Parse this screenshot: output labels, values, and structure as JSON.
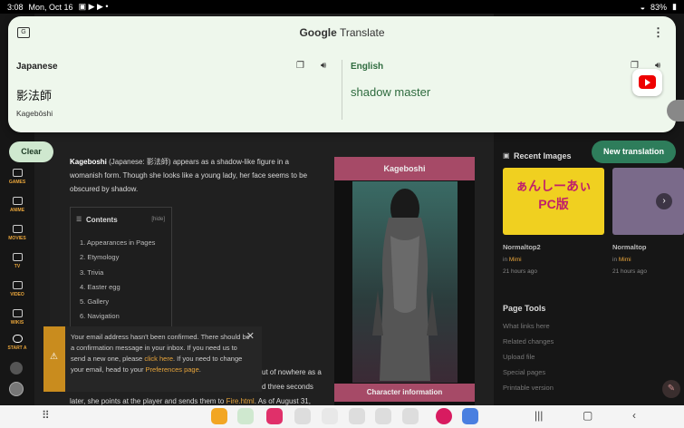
{
  "status_bar": {
    "time": "3:08",
    "date": "Mon, Oct 16",
    "battery": "83%"
  },
  "wiki": {
    "rail": [
      {
        "label": "GAMES",
        "icon": "gamepad-icon"
      },
      {
        "label": "ANIME",
        "icon": "tv-icon"
      },
      {
        "label": "MOVIES",
        "icon": "film-icon"
      },
      {
        "label": "TV",
        "icon": "tv-icon"
      },
      {
        "label": "VIDEO",
        "icon": "video-icon"
      },
      {
        "label": "WIKIS",
        "icon": "book-icon"
      },
      {
        "label": "START A",
        "icon": "plus-icon"
      }
    ],
    "intro_name": "Kageboshi",
    "intro_rest": " (Japanese: 影法師) appears as a shadow-like figure in a womanish form. Though she looks like a young lady, her face seems to be obscured by shadow.",
    "toc": {
      "title": "Contents",
      "hide": "[hide]",
      "items": [
        "1. Appearances in Pages",
        "2. Etymology",
        "3. Trivia",
        "4. Easter egg",
        "5. Gallery",
        "6. Navigation"
      ]
    },
    "body_frag_1": "ut of nowhere as a",
    "body_frag_2": "d three seconds",
    "body_frag_3": "later, she points at the player and sends them to ",
    "body_link": "Fire.html",
    "body_frag_4": ". As of August 31,",
    "infobox": {
      "title": "Kageboshi",
      "footer": "Character information"
    },
    "sidebar": {
      "recent_title": "Recent Images",
      "images": [
        {
          "title": "Normaltop2",
          "in": "in",
          "author": "Mimi",
          "time": "21 hours ago",
          "caption": "ぁんしーあぃ\nPC版"
        },
        {
          "title": "Normaltop",
          "in": "in",
          "author": "Mimi",
          "time": "21 hours ago"
        }
      ],
      "tools_title": "Page Tools",
      "tools": [
        "What links here",
        "Related changes",
        "Upload file",
        "Special pages",
        "Printable version"
      ]
    },
    "notice": {
      "text1": "Your email address hasn't been confirmed. There should be a confirmation message in your inbox. If you need us to send a new one, please ",
      "link1": "click here",
      "text2": ". If you need to change your email, head to your ",
      "link2": "Preferences page",
      "text3": "."
    }
  },
  "translate": {
    "brand": "Google",
    "app": "Translate",
    "source_lang": "Japanese",
    "target_lang": "English",
    "source_text": "影法師",
    "romanization": "Kagebōshi",
    "target_text": "shadow master",
    "clear_label": "Clear",
    "new_label": "New translation"
  }
}
